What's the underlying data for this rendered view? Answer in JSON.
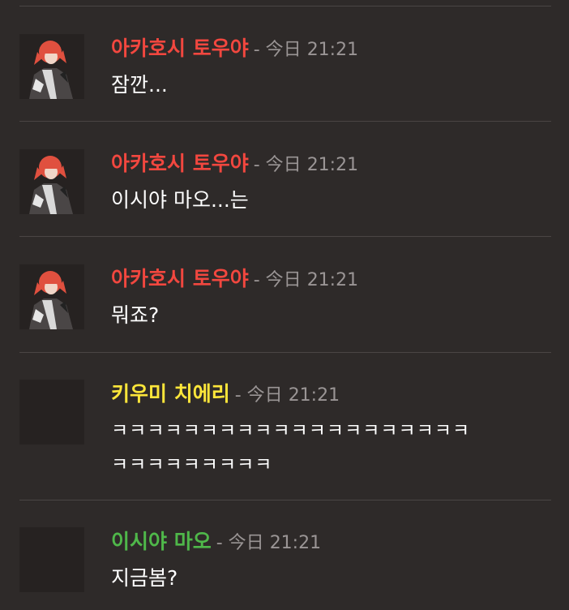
{
  "colors": {
    "background": "#2e2a29",
    "divider": "#4a4544",
    "author_red": "#f2473f",
    "author_yellow": "#fde63a",
    "author_green": "#4fb84a",
    "timestamp": "#9a9595",
    "text": "#ffffff"
  },
  "messages": [
    {
      "author": "아카호시 토우야",
      "author_color": "#f2473f",
      "separator": "-",
      "day": "今日",
      "time": "21:21",
      "text": "잠깐...",
      "avatar": "red-haired-character-avatar"
    },
    {
      "author": "아카호시 토우야",
      "author_color": "#f2473f",
      "separator": "-",
      "day": "今日",
      "time": "21:21",
      "text": "이시야 마오...는",
      "avatar": "red-haired-character-avatar"
    },
    {
      "author": "아카호시 토우야",
      "author_color": "#f2473f",
      "separator": "-",
      "day": "今日",
      "time": "21:21",
      "text": "뭐죠?",
      "avatar": "red-haired-character-avatar"
    },
    {
      "author": "키우미 치에리",
      "author_color": "#fde63a",
      "separator": "-",
      "day": "今日",
      "time": "21:21",
      "text": "ㅋㅋㅋㅋㅋㅋㅋㅋㅋㅋㅋㅋㅋㅋㅋㅋㅋㅋㅋㅋ\nㅋㅋㅋㅋㅋㅋㅋㅋㅋ",
      "avatar": "blank-avatar"
    },
    {
      "author": "이시야 마오",
      "author_color": "#4fb84a",
      "separator": "-",
      "day": "今日",
      "time": "21:21",
      "text": "지금봄?",
      "avatar": "blank-avatar"
    }
  ]
}
